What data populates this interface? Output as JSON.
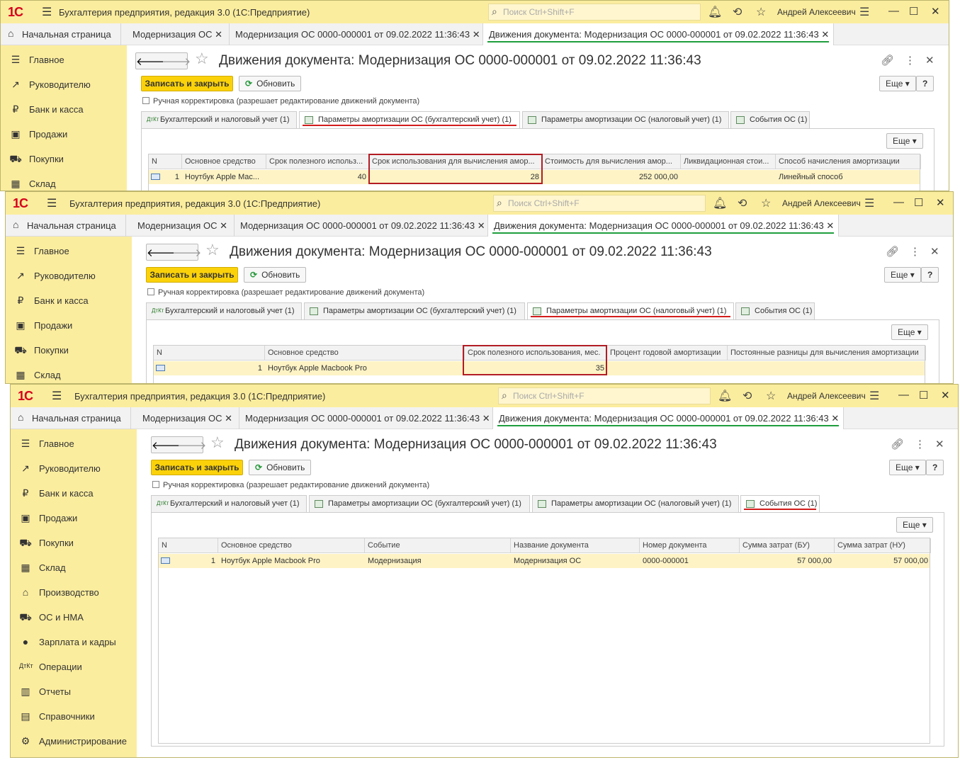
{
  "app": {
    "title": "Бухгалтерия предприятия, редакция 3.0  (1С:Предприятие)",
    "logo": "1С",
    "search_placeholder": "Поиск Ctrl+Shift+F",
    "user": "Андрей Алексеевич"
  },
  "top_tabs": {
    "home": "Начальная страница",
    "tab1": "Модернизация ОС",
    "tab2": "Модернизация ОС 0000-000001 от 09.02.2022 11:36:43",
    "tab3": "Движения документа: Модернизация ОС 0000-000001 от 09.02.2022 11:36:43"
  },
  "sidebar": {
    "items": [
      {
        "label": "Главное",
        "icon": "menu-icon"
      },
      {
        "label": "Руководителю",
        "icon": "trend-icon"
      },
      {
        "label": "Банк и касса",
        "icon": "coin-icon"
      },
      {
        "label": "Продажи",
        "icon": "bag-icon"
      },
      {
        "label": "Покупки",
        "icon": "cart-icon"
      },
      {
        "label": "Склад",
        "icon": "grid-icon"
      },
      {
        "label": "Производство",
        "icon": "factory-icon"
      },
      {
        "label": "ОС и НМА",
        "icon": "truck-icon"
      },
      {
        "label": "Зарплата и кадры",
        "icon": "person-icon"
      },
      {
        "label": "Операции",
        "icon": "dt-kt-icon"
      },
      {
        "label": "Отчеты",
        "icon": "bar-chart-icon"
      },
      {
        "label": "Справочники",
        "icon": "book-icon"
      },
      {
        "label": "Администрирование",
        "icon": "gear-icon"
      }
    ]
  },
  "doc": {
    "title": "Движения документа: Модернизация ОС 0000-000001 от 09.02.2022 11:36:43",
    "save_close": "Записать и закрыть",
    "refresh": "Обновить",
    "more": "Еще",
    "help": "?",
    "manual": "Ручная корректировка (разрешает редактирование движений документа)",
    "tabs": [
      "Бухгалтерский и налоговый учет (1)",
      "Параметры амортизации ОС (бухгалтерский учет) (1)",
      "Параметры амортизации ОС (налоговый учет) (1)",
      "События ОС (1)"
    ]
  },
  "table1": {
    "headers": [
      "N",
      "Основное средство",
      "Срок полезного использ...",
      "Срок использования для вычисления амор...",
      "Стоимость для вычисления амор...",
      "Ликвидационная стои...",
      "Способ начисления амортизации"
    ],
    "row": [
      "1",
      "Ноутбук Apple Mac...",
      "40",
      "28",
      "252 000,00",
      "",
      "Линейный способ"
    ]
  },
  "table2": {
    "headers": [
      "N",
      "Основное средство",
      "Срок полезного использования, мес.",
      "Процент годовой амортизации",
      "Постоянные разницы для вычисления амортизации"
    ],
    "row": [
      "1",
      "Ноутбук Apple Macbook Pro",
      "35",
      "",
      ""
    ]
  },
  "table3": {
    "headers": [
      "N",
      "Основное средство",
      "Событие",
      "Название документа",
      "Номер документа",
      "Сумма затрат (БУ)",
      "Сумма затрат (НУ)"
    ],
    "row": [
      "1",
      "Ноутбук Apple Macbook Pro",
      "Модернизация",
      "Модернизация ОС",
      "0000-000001",
      "57 000,00",
      "57 000,00"
    ]
  },
  "colors": {
    "accent_yellow": "#fbed9e",
    "button_yellow": "#fbd20a",
    "highlight_red": "#b21c24",
    "active_green": "#1f9e3e"
  }
}
